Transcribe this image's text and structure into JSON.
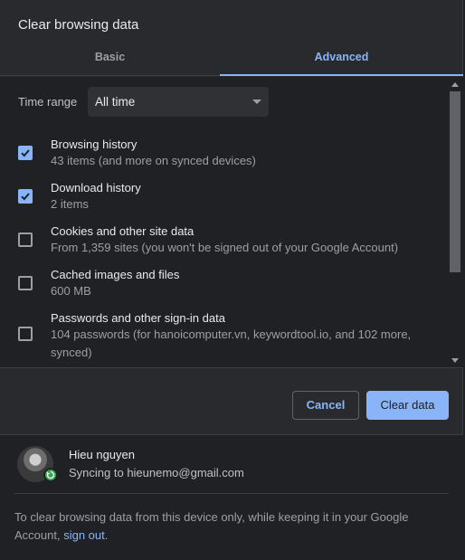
{
  "dialog": {
    "title": "Clear browsing data"
  },
  "tabs": [
    {
      "label": "Basic"
    },
    {
      "label": "Advanced"
    }
  ],
  "time_range": {
    "label": "Time range",
    "value": "All time"
  },
  "options": [
    {
      "title": "Browsing history",
      "desc": "43 items (and more on synced devices)",
      "checked": true
    },
    {
      "title": "Download history",
      "desc": "2 items",
      "checked": true
    },
    {
      "title": "Cookies and other site data",
      "desc": "From 1,359 sites (you won't be signed out of your Google Account)",
      "checked": false
    },
    {
      "title": "Cached images and files",
      "desc": "600 MB",
      "checked": false
    },
    {
      "title": "Passwords and other sign-in data",
      "desc": "104 passwords (for hanoicomputer.vn, keywordtool.io, and 102 more, synced)",
      "checked": false
    }
  ],
  "buttons": {
    "cancel": "Cancel",
    "clear": "Clear data"
  },
  "account": {
    "name": "Hieu nguyen",
    "sync_text": "Syncing to hieunemo@gmail.com"
  },
  "info": {
    "text": "To clear browsing data from this device only, while keeping it in your Google Account,",
    "link": "sign out",
    "tail": "."
  },
  "colors": {
    "accent": "#8ab4f8",
    "background": "#202124",
    "surface": "#292a2d",
    "sync_badge": "#34a853"
  }
}
